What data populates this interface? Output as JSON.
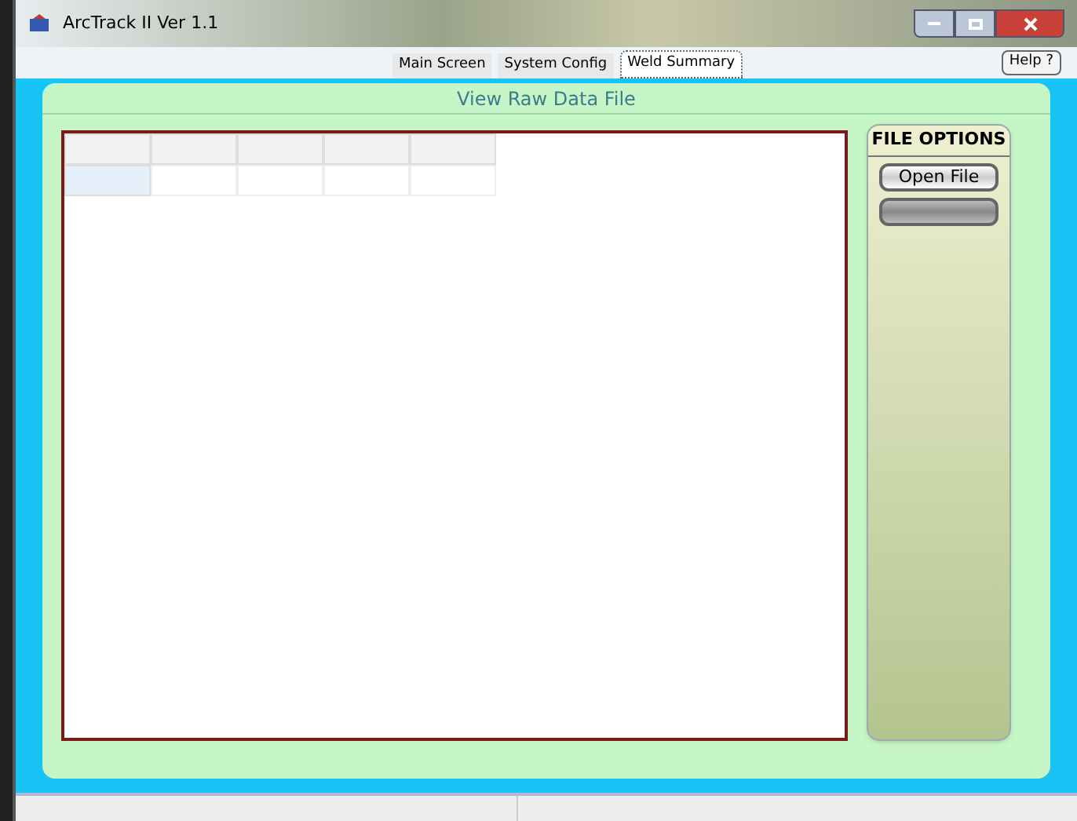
{
  "window": {
    "title": "ArcTrack II Ver 1.1"
  },
  "tabs": [
    {
      "label": "Main Screen",
      "selected": false
    },
    {
      "label": "System Config",
      "selected": false
    },
    {
      "label": "Weld Summary",
      "selected": true
    }
  ],
  "help_button": "Help ?",
  "panel": {
    "title": "View Raw Data File"
  },
  "file_options": {
    "title": "FILE OPTIONS",
    "buttons": [
      {
        "label": "Open File",
        "disabled": false
      },
      {
        "disabled": true
      }
    ]
  }
}
